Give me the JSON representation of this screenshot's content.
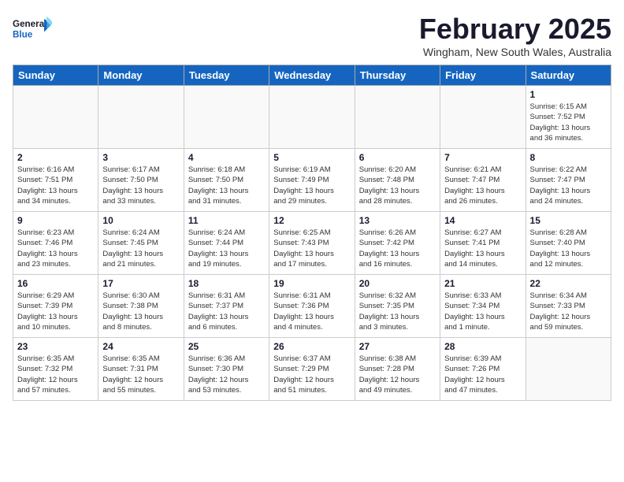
{
  "header": {
    "logo_general": "General",
    "logo_blue": "Blue",
    "title": "February 2025",
    "subtitle": "Wingham, New South Wales, Australia"
  },
  "weekdays": [
    "Sunday",
    "Monday",
    "Tuesday",
    "Wednesday",
    "Thursday",
    "Friday",
    "Saturday"
  ],
  "weeks": [
    [
      {
        "day": "",
        "detail": ""
      },
      {
        "day": "",
        "detail": ""
      },
      {
        "day": "",
        "detail": ""
      },
      {
        "day": "",
        "detail": ""
      },
      {
        "day": "",
        "detail": ""
      },
      {
        "day": "",
        "detail": ""
      },
      {
        "day": "1",
        "detail": "Sunrise: 6:15 AM\nSunset: 7:52 PM\nDaylight: 13 hours\nand 36 minutes."
      }
    ],
    [
      {
        "day": "2",
        "detail": "Sunrise: 6:16 AM\nSunset: 7:51 PM\nDaylight: 13 hours\nand 34 minutes."
      },
      {
        "day": "3",
        "detail": "Sunrise: 6:17 AM\nSunset: 7:50 PM\nDaylight: 13 hours\nand 33 minutes."
      },
      {
        "day": "4",
        "detail": "Sunrise: 6:18 AM\nSunset: 7:50 PM\nDaylight: 13 hours\nand 31 minutes."
      },
      {
        "day": "5",
        "detail": "Sunrise: 6:19 AM\nSunset: 7:49 PM\nDaylight: 13 hours\nand 29 minutes."
      },
      {
        "day": "6",
        "detail": "Sunrise: 6:20 AM\nSunset: 7:48 PM\nDaylight: 13 hours\nand 28 minutes."
      },
      {
        "day": "7",
        "detail": "Sunrise: 6:21 AM\nSunset: 7:47 PM\nDaylight: 13 hours\nand 26 minutes."
      },
      {
        "day": "8",
        "detail": "Sunrise: 6:22 AM\nSunset: 7:47 PM\nDaylight: 13 hours\nand 24 minutes."
      }
    ],
    [
      {
        "day": "9",
        "detail": "Sunrise: 6:23 AM\nSunset: 7:46 PM\nDaylight: 13 hours\nand 23 minutes."
      },
      {
        "day": "10",
        "detail": "Sunrise: 6:24 AM\nSunset: 7:45 PM\nDaylight: 13 hours\nand 21 minutes."
      },
      {
        "day": "11",
        "detail": "Sunrise: 6:24 AM\nSunset: 7:44 PM\nDaylight: 13 hours\nand 19 minutes."
      },
      {
        "day": "12",
        "detail": "Sunrise: 6:25 AM\nSunset: 7:43 PM\nDaylight: 13 hours\nand 17 minutes."
      },
      {
        "day": "13",
        "detail": "Sunrise: 6:26 AM\nSunset: 7:42 PM\nDaylight: 13 hours\nand 16 minutes."
      },
      {
        "day": "14",
        "detail": "Sunrise: 6:27 AM\nSunset: 7:41 PM\nDaylight: 13 hours\nand 14 minutes."
      },
      {
        "day": "15",
        "detail": "Sunrise: 6:28 AM\nSunset: 7:40 PM\nDaylight: 13 hours\nand 12 minutes."
      }
    ],
    [
      {
        "day": "16",
        "detail": "Sunrise: 6:29 AM\nSunset: 7:39 PM\nDaylight: 13 hours\nand 10 minutes."
      },
      {
        "day": "17",
        "detail": "Sunrise: 6:30 AM\nSunset: 7:38 PM\nDaylight: 13 hours\nand 8 minutes."
      },
      {
        "day": "18",
        "detail": "Sunrise: 6:31 AM\nSunset: 7:37 PM\nDaylight: 13 hours\nand 6 minutes."
      },
      {
        "day": "19",
        "detail": "Sunrise: 6:31 AM\nSunset: 7:36 PM\nDaylight: 13 hours\nand 4 minutes."
      },
      {
        "day": "20",
        "detail": "Sunrise: 6:32 AM\nSunset: 7:35 PM\nDaylight: 13 hours\nand 3 minutes."
      },
      {
        "day": "21",
        "detail": "Sunrise: 6:33 AM\nSunset: 7:34 PM\nDaylight: 13 hours\nand 1 minute."
      },
      {
        "day": "22",
        "detail": "Sunrise: 6:34 AM\nSunset: 7:33 PM\nDaylight: 12 hours\nand 59 minutes."
      }
    ],
    [
      {
        "day": "23",
        "detail": "Sunrise: 6:35 AM\nSunset: 7:32 PM\nDaylight: 12 hours\nand 57 minutes."
      },
      {
        "day": "24",
        "detail": "Sunrise: 6:35 AM\nSunset: 7:31 PM\nDaylight: 12 hours\nand 55 minutes."
      },
      {
        "day": "25",
        "detail": "Sunrise: 6:36 AM\nSunset: 7:30 PM\nDaylight: 12 hours\nand 53 minutes."
      },
      {
        "day": "26",
        "detail": "Sunrise: 6:37 AM\nSunset: 7:29 PM\nDaylight: 12 hours\nand 51 minutes."
      },
      {
        "day": "27",
        "detail": "Sunrise: 6:38 AM\nSunset: 7:28 PM\nDaylight: 12 hours\nand 49 minutes."
      },
      {
        "day": "28",
        "detail": "Sunrise: 6:39 AM\nSunset: 7:26 PM\nDaylight: 12 hours\nand 47 minutes."
      },
      {
        "day": "",
        "detail": ""
      }
    ]
  ]
}
